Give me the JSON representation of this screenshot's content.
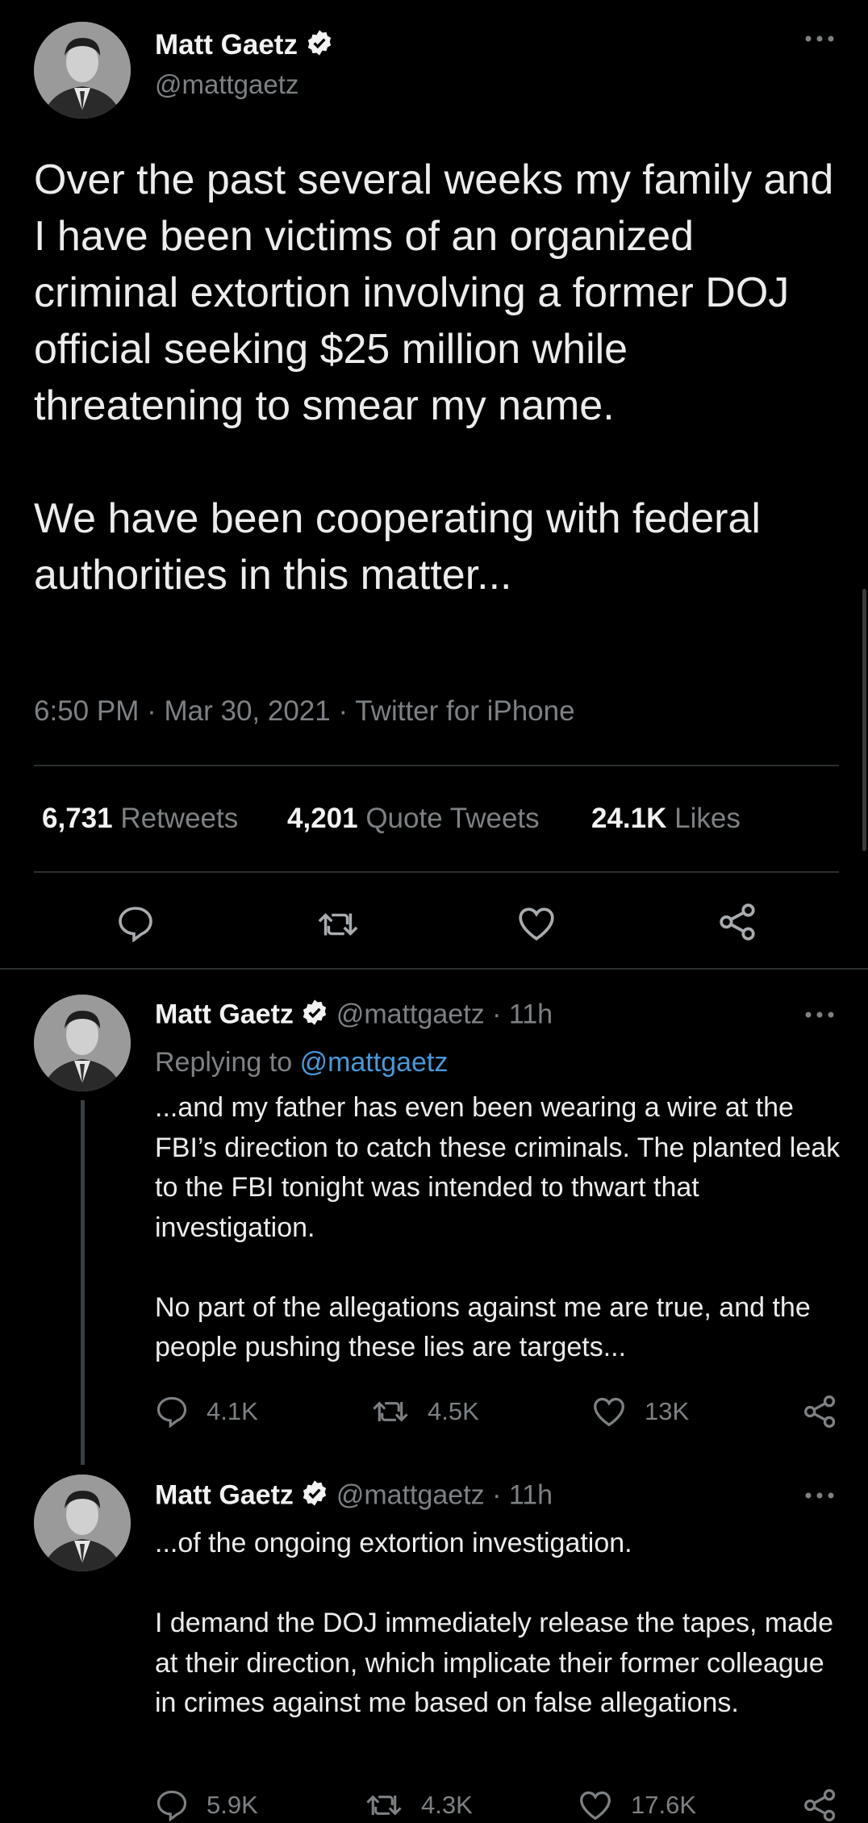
{
  "main_tweet": {
    "name": "Matt Gaetz",
    "handle": "@mattgaetz",
    "text": "Over the past several weeks my family and I have been victims of an organized criminal extortion involving a former DOJ official seeking $25 million while threatening to smear my name.\n\nWe have been cooperating with federal authorities in this matter...",
    "time": "6:50 PM",
    "date": "Mar 30, 2021",
    "source": "Twitter for iPhone",
    "retweets_count": "6,731",
    "retweets_label": "Retweets",
    "quotes_count": "4,201",
    "quotes_label": "Quote Tweets",
    "likes_count": "24.1K",
    "likes_label": "Likes"
  },
  "replies": [
    {
      "name": "Matt Gaetz",
      "handle": "@mattgaetz",
      "age": "11h",
      "replying_prefix": "Replying to",
      "replying_to": "@mattgaetz",
      "text": "...and my father has even been wearing a wire at the FBI’s direction to catch these criminals. The planted leak to the FBI tonight was intended to thwart that investigation.\n\nNo part of the allegations against me are true, and the people pushing these lies are targets...",
      "replies": "4.1K",
      "retweets": "4.5K",
      "likes": "13K"
    },
    {
      "name": "Matt Gaetz",
      "handle": "@mattgaetz",
      "age": "11h",
      "text": "...of the ongoing extortion investigation.\n\nI demand the DOJ immediately release the tapes, made at their direction, which implicate their former colleague in crimes against me based on false allegations.",
      "replies": "5.9K",
      "retweets": "4.3K",
      "likes": "17.6K"
    }
  ],
  "separator_dot": "·",
  "colors": {
    "background": "#000000",
    "text": "#e7e9ea",
    "muted": "#7d8184",
    "link": "#4a98d8"
  }
}
